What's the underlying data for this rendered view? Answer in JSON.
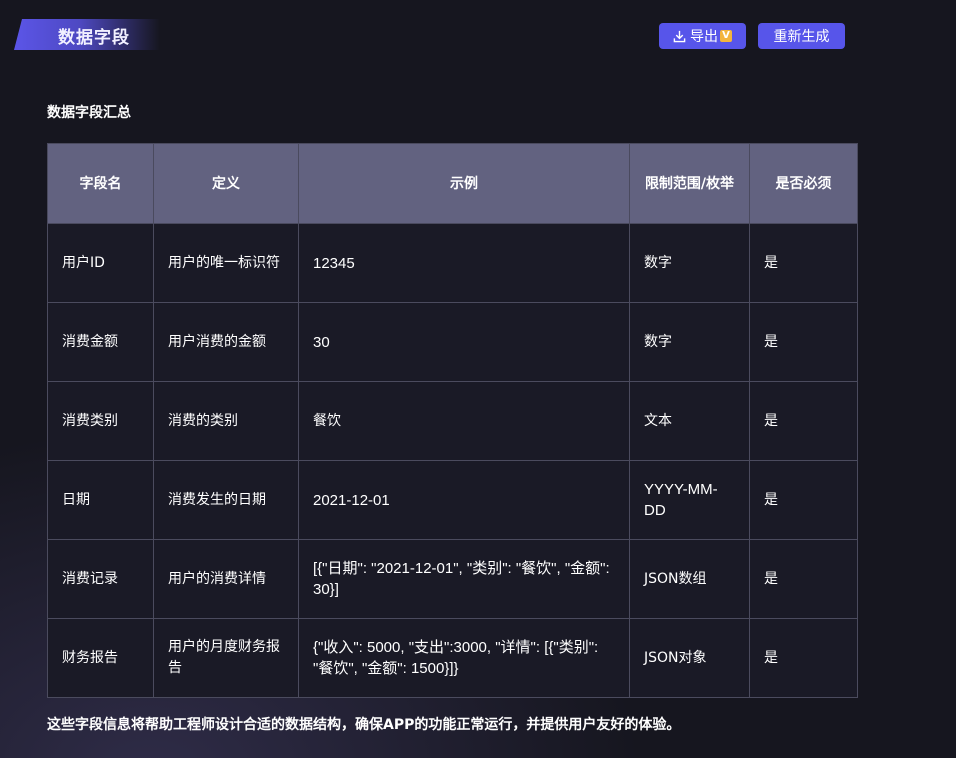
{
  "header": {
    "title": "数据字段",
    "export_label": "导出",
    "regenerate_label": "重新生成",
    "accent_color": "#5755ea"
  },
  "section": {
    "title": "数据字段汇总"
  },
  "table": {
    "columns": [
      "字段名",
      "定义",
      "示例",
      "限制范围/枚举",
      "是否必须"
    ],
    "rows": [
      [
        "用户ID",
        "用户的唯一标识符",
        "12345",
        "数字",
        "是"
      ],
      [
        "消费金额",
        "用户消费的金额",
        "30",
        "数字",
        "是"
      ],
      [
        "消费类别",
        "消费的类别",
        "餐饮",
        "文本",
        "是"
      ],
      [
        "日期",
        "消费发生的日期",
        "2021-12-01",
        "YYYY-MM-DD",
        "是"
      ],
      [
        "消费记录",
        "用户的消费详情",
        "[{\"日期\": \"2021-12-01\", \"类别\": \"餐饮\", \"金额\": 30}]",
        "JSON数组",
        "是"
      ],
      [
        "财务报告",
        "用户的月度财务报告",
        "{\"收入\": 5000, \"支出\":3000, \"详情\": [{\"类别\": \"餐饮\", \"金额\": 1500}]}",
        "JSON对象",
        "是"
      ]
    ]
  },
  "footer": {
    "note": "这些字段信息将帮助工程师设计合适的数据结构，确保APP的功能正常运行，并提供用户友好的体验。"
  }
}
